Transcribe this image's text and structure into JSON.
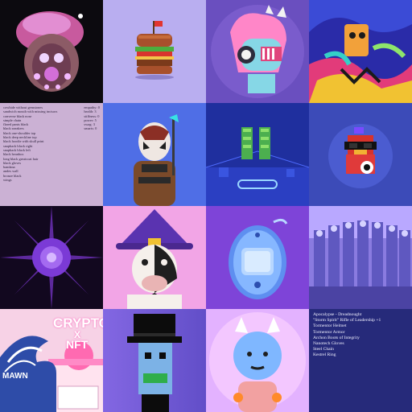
{
  "loot_list": {
    "items": [
      "cowhide without gemstones",
      "sandwich mouth with missing incisors",
      "converse black nose",
      "simple chain",
      "flared pants black",
      "black sneakers",
      "black one-shoulder top",
      "black deep neckline top",
      "black hoodie with skull print",
      "snapback black right",
      "snapback black left",
      "black beanbox",
      "long black greatcoat hair",
      "black gloves",
      "bandana",
      "andes wall",
      "bronze black",
      "wings"
    ],
    "stats": [
      "empathy: 0",
      "health: 3",
      "stiffness: 0",
      "power: 5",
      "swag: 3",
      "smarts: 0"
    ]
  },
  "gear_list": {
    "items": [
      "Apocalypse - Dreadnought",
      "\"Storm Spirit\" Rifle of Leadership +1",
      "Tormentor Helmet",
      "Tormentor Armor",
      "Archon Boots of Integrity",
      "Nanotech Gloves",
      "Steel Chain",
      "Kestrel Ring"
    ]
  },
  "crypto_art": {
    "title_line1": "CRYPTO",
    "title_line2": "X",
    "title_line3": "NFT",
    "caption": "MAWN"
  },
  "icons": [
    "burger-flag-icon",
    "tamagotchi-device-icon",
    "purple-star-orb-icon",
    "top-hat-icon"
  ],
  "colors": {
    "loot_bg": "#cbb1d4",
    "gear_bg": "#262a7a",
    "accent": "#ff52b4"
  }
}
